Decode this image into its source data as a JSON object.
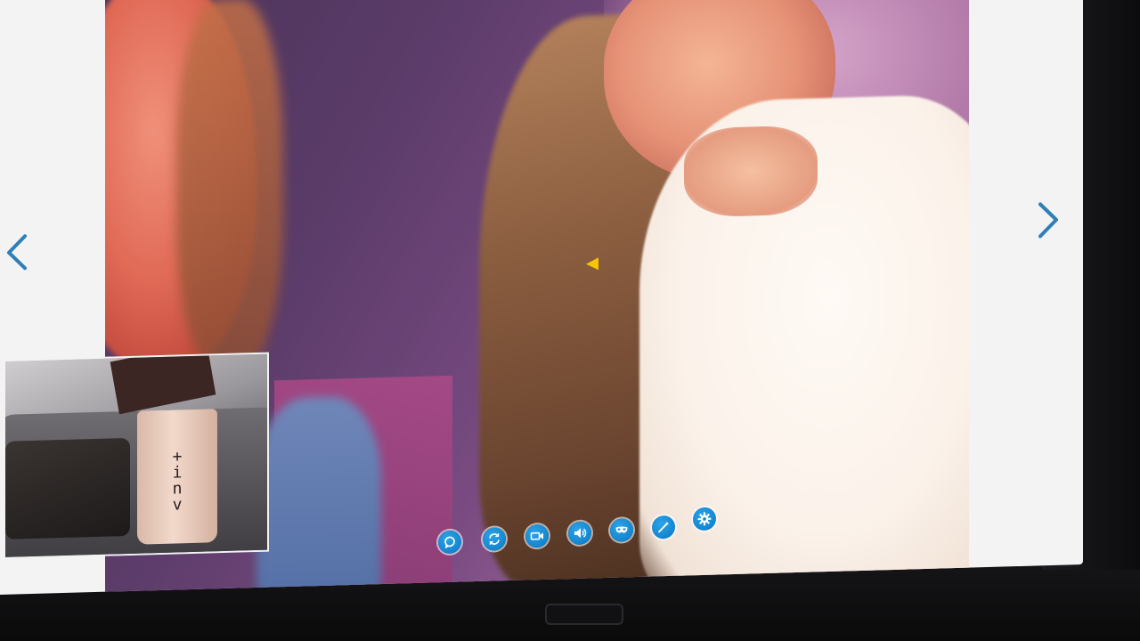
{
  "navigation": {
    "prev_icon": "chevron-left-icon",
    "next_icon": "chevron-right-icon",
    "accent_color": "#2f7fb7"
  },
  "local_preview": {
    "cup_text": "+\ni\nn\nv"
  },
  "controls": [
    {
      "name": "chat-button",
      "icon": "chat-bubble-icon"
    },
    {
      "name": "switch-camera-button",
      "icon": "refresh-icon"
    },
    {
      "name": "video-toggle-button",
      "icon": "video-camera-icon"
    },
    {
      "name": "audio-toggle-button",
      "icon": "speaker-icon"
    },
    {
      "name": "mask-button",
      "icon": "mask-icon"
    },
    {
      "name": "effects-button",
      "icon": "magic-wand-icon"
    },
    {
      "name": "settings-button",
      "icon": "gear-icon"
    }
  ],
  "colors": {
    "control_blue": "#1285cf",
    "page_background": "#f3f3f4",
    "cursor_yellow": "#f6c400"
  }
}
